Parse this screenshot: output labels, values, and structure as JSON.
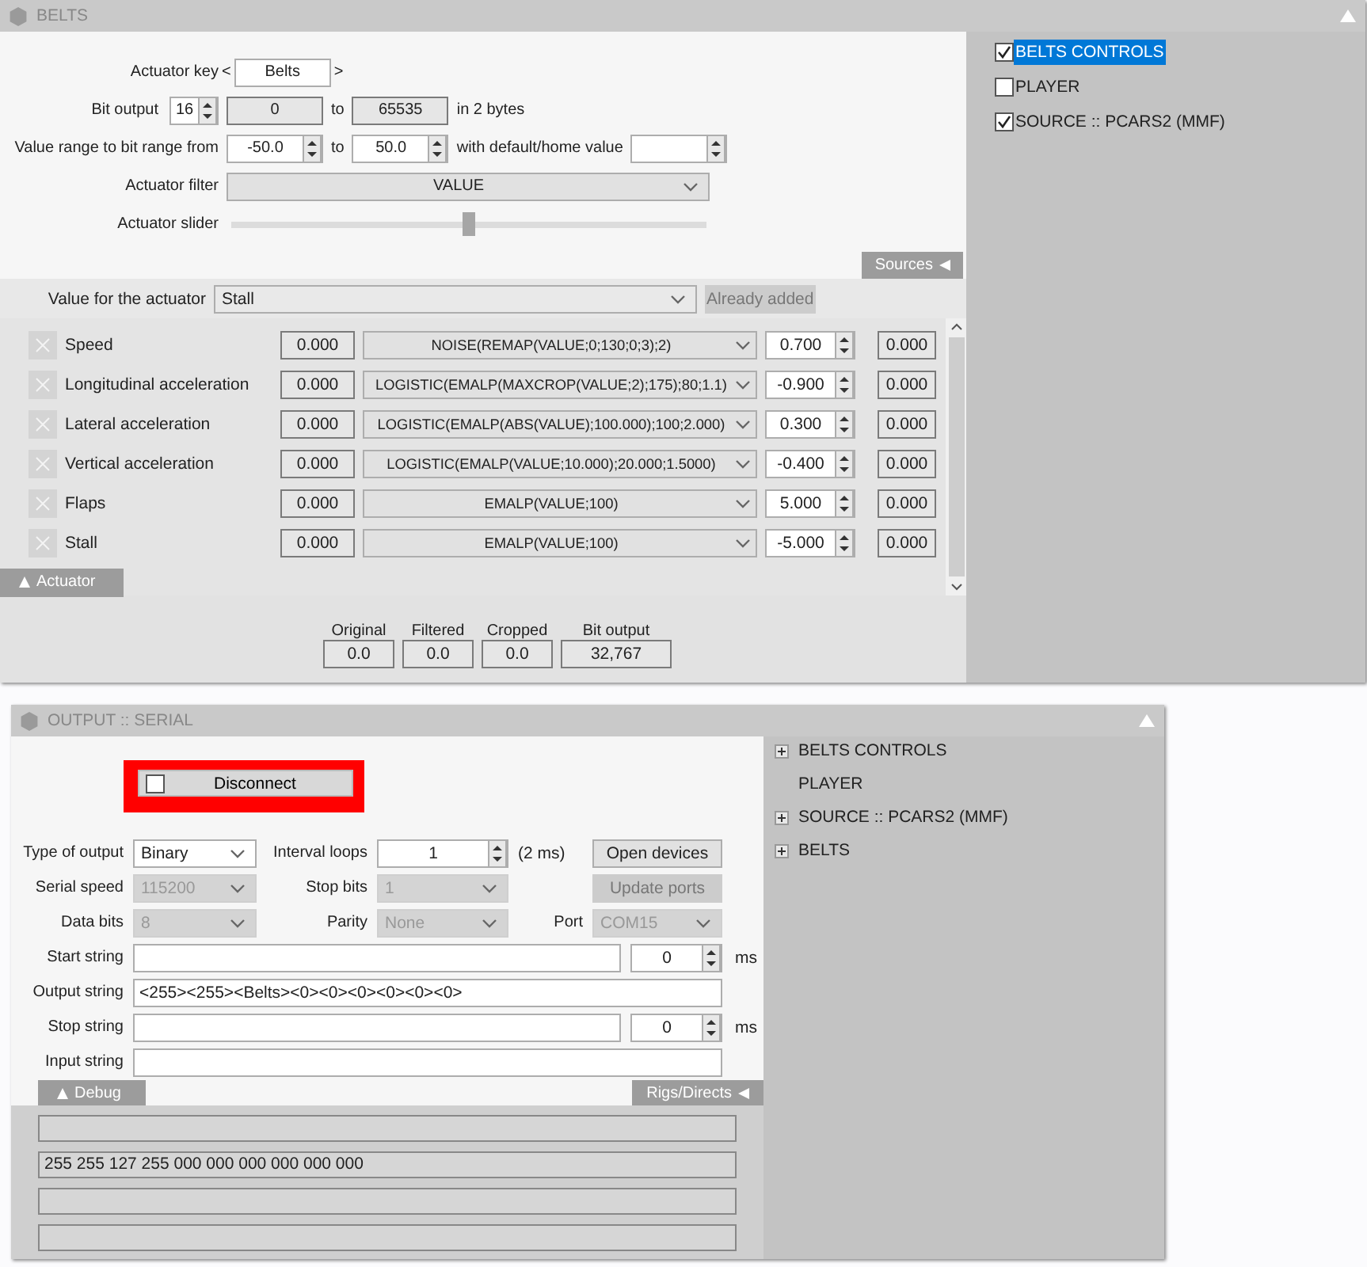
{
  "belts_window": {
    "title": "BELTS",
    "actuator_key": {
      "label": "Actuator key",
      "prev": "<",
      "value": "Belts",
      "next": ">"
    },
    "bit_output": {
      "label": "Bit output",
      "bits": "16",
      "from": "0",
      "to_label": "to",
      "to": "65535",
      "suffix": "in 2 bytes"
    },
    "value_range": {
      "label": "Value range to bit range from",
      "from": "-50.0",
      "to_label": "to",
      "to": "50.0",
      "default_label": "with default/home value"
    },
    "filter": {
      "label": "Actuator filter",
      "value": "VALUE"
    },
    "slider": {
      "label": "Actuator slider",
      "level": 0.5
    },
    "sources_tab": "Sources",
    "value_for_actuator": {
      "label": "Value for the actuator",
      "value": "Stall"
    },
    "already_added": {
      "label": "Already added",
      "disabled": true
    },
    "inputs": [
      {
        "name": "Speed",
        "raw": "0.000",
        "formula": "NOISE(REMAP(VALUE;0;130;0;3);2)",
        "factor": "0.700",
        "result": "0.000"
      },
      {
        "name": "Longitudinal acceleration",
        "raw": "0.000",
        "formula": "LOGISTIC(EMALP(MAXCROP(VALUE;2);175);80;1.1)",
        "factor": "-0.900",
        "result": "0.000"
      },
      {
        "name": "Lateral acceleration",
        "raw": "0.000",
        "formula": "LOGISTIC(EMALP(ABS(VALUE);100.000);100;2.000)",
        "factor": "0.300",
        "result": "0.000"
      },
      {
        "name": "Vertical acceleration",
        "raw": "0.000",
        "formula": "LOGISTIC(EMALP(VALUE;10.000);20.000;1.5000)",
        "factor": "-0.400",
        "result": "0.000"
      },
      {
        "name": "Flaps",
        "raw": "0.000",
        "formula": "EMALP(VALUE;100)",
        "factor": "5.000",
        "result": "0.000"
      },
      {
        "name": "Stall",
        "raw": "0.000",
        "formula": "EMALP(VALUE;100)",
        "factor": "-5.000",
        "result": "0.000"
      }
    ],
    "actuator_tab": "Actuator",
    "readouts": [
      {
        "label": "Original",
        "value": "0.0"
      },
      {
        "label": "Filtered",
        "value": "0.0"
      },
      {
        "label": "Cropped",
        "value": "0.0"
      },
      {
        "label": "Bit output",
        "value": "32,767"
      }
    ],
    "side_list": [
      {
        "label": "BELTS CONTROLS",
        "checked": true,
        "selected": true
      },
      {
        "label": "PLAYER",
        "checked": false,
        "selected": false
      },
      {
        "label": "SOURCE :: PCARS2 (MMF)",
        "checked": true,
        "selected": false
      }
    ]
  },
  "output_window": {
    "title": "OUTPUT :: SERIAL",
    "disconnect": {
      "label": "Disconnect",
      "checked": false,
      "highlighted": true
    },
    "type_of_output": {
      "label": "Type of output",
      "value": "Binary",
      "disabled": false
    },
    "interval_loops": {
      "label": "Interval loops",
      "value": "1",
      "note": "(2 ms)"
    },
    "open_devices": {
      "label": "Open devices",
      "disabled": false
    },
    "serial_speed": {
      "label": "Serial speed",
      "value": "115200",
      "disabled": true
    },
    "stop_bits": {
      "label": "Stop bits",
      "value": "1",
      "disabled": true
    },
    "update_ports": {
      "label": "Update ports",
      "disabled": true
    },
    "data_bits": {
      "label": "Data bits",
      "value": "8",
      "disabled": true
    },
    "parity": {
      "label": "Parity",
      "value": "None",
      "disabled": true
    },
    "port": {
      "label": "Port",
      "value": "COM15",
      "disabled": true
    },
    "start_string": {
      "label": "Start string",
      "delay": "0",
      "unit": "ms"
    },
    "output_string": {
      "label": "Output string",
      "value": "<255><255><Belts><0><0><0><0><0><0>"
    },
    "stop_string": {
      "label": "Stop string",
      "delay": "0",
      "unit": "ms"
    },
    "input_string": {
      "label": "Input string"
    },
    "debug_tab": "Debug",
    "rigs_tab": "Rigs/Directs",
    "debug_lines": [
      {
        "kind": "empty"
      },
      {
        "kind": "text",
        "text": "255 255 127 255 000 000 000 000 000 000"
      },
      {
        "kind": "empty"
      },
      {
        "kind": "empty"
      }
    ],
    "tree": [
      {
        "label": "BELTS CONTROLS",
        "expandable": true
      },
      {
        "label": "PLAYER",
        "expandable": false
      },
      {
        "label": "SOURCE :: PCARS2 (MMF)",
        "expandable": true
      },
      {
        "label": "BELTS",
        "expandable": true
      }
    ]
  }
}
